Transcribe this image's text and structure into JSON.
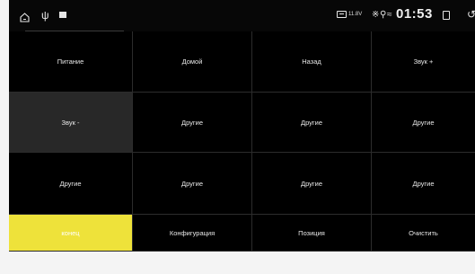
{
  "status_bar": {
    "battery_voltage": "11.8V",
    "clock": "01:53",
    "icons": [
      "home-icon",
      "usb-icon",
      "square-icon",
      "battery-icon",
      "bluetooth-icon",
      "location-icon",
      "wifi-icon",
      "recents-icon",
      "back-icon"
    ]
  },
  "grid": {
    "items": [
      {
        "label": "Питание"
      },
      {
        "label": "Домой"
      },
      {
        "label": "Назад"
      },
      {
        "label": "Звук +"
      },
      {
        "label": "Звук -"
      },
      {
        "label": "Другие"
      },
      {
        "label": "Другие"
      },
      {
        "label": "Другие"
      },
      {
        "label": "Другие"
      },
      {
        "label": "Другие"
      },
      {
        "label": "Другие"
      },
      {
        "label": "Другие"
      },
      {
        "label": "конец"
      },
      {
        "label": "Конфигурация"
      },
      {
        "label": "Позиция"
      },
      {
        "label": "Очистить"
      }
    ]
  },
  "colors": {
    "background": "#000000",
    "gray_cell": "#282828",
    "highlight": "#eee23a"
  }
}
